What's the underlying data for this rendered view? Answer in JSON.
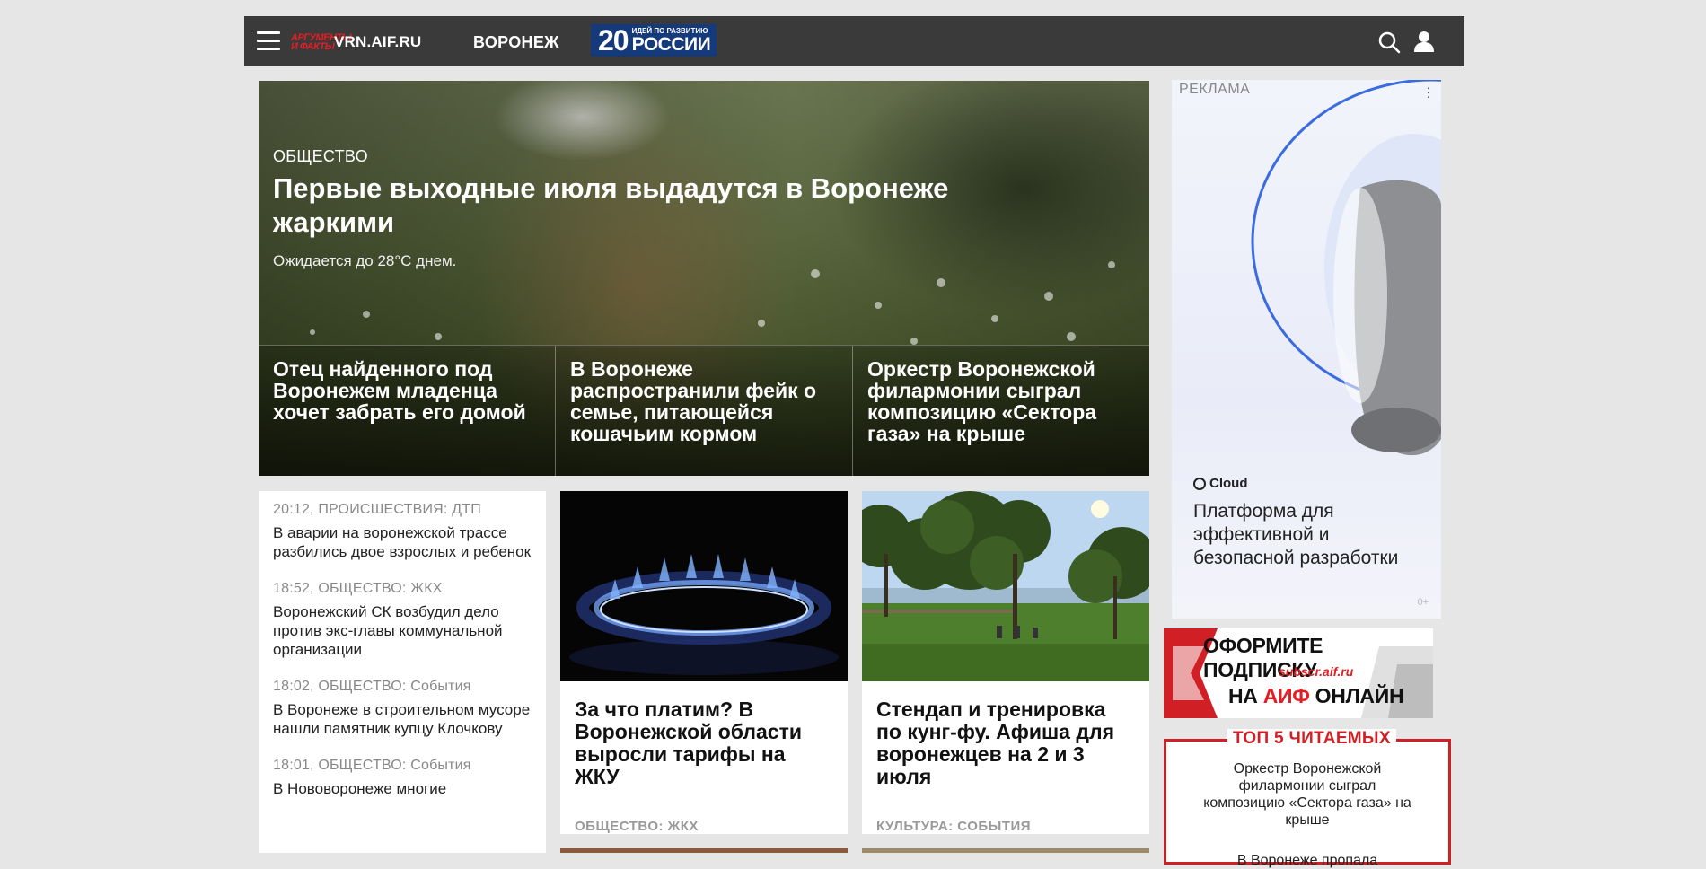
{
  "header": {
    "logo_mark": "АРГУМЕНТЫ И ФАКТЫ",
    "site": "VRN.AIF.RU",
    "city": "ВОРОНЕЖ",
    "promo_number": "20",
    "promo_small": "ИДЕЙ ПО РАЗВИТИЮ",
    "promo_big": "РОССИИ"
  },
  "hero": {
    "rubric": "ОБЩЕСТВО",
    "title": "Первые выходные июля выдадутся в Воронеже жаркими",
    "subtitle": "Ожидается до 28°C днем.",
    "cards": [
      {
        "title": "Отец найденного под Воронежем младенца хочет забрать его домой"
      },
      {
        "title": "В Воронеже распространили фейк о семье, питающейся кошачьим кормом"
      },
      {
        "title": "Оркестр Воронежской филармонии сыграл композицию «Сектора газа» на крыше"
      }
    ]
  },
  "news": [
    {
      "meta": "20:12, ПРОИСШЕСТВИЯ: ДТП",
      "title": "В аварии на воронежской трассе разбились двое взрослых и ребенок"
    },
    {
      "meta": "18:52, ОБЩЕСТВО: ЖКХ",
      "title": "Воронежский СК возбудил дело против экс-главы коммунальной организации"
    },
    {
      "meta": "18:02, ОБЩЕСТВО: События",
      "title": "В Воронеже в строительном мусоре нашли памятник купцу Клочкову"
    },
    {
      "meta": "18:01, ОБЩЕСТВО: События",
      "title": "В Нововоронеже многие"
    }
  ],
  "cards": [
    {
      "title": "За что платим? В Воронежской области выросли тарифы на ЖКУ",
      "tag": "ОБЩЕСТВО: ЖКХ",
      "image": "gas-burner-flame"
    },
    {
      "title": "Стендап и тренировка по кунг-фу. Афиша для воронежцев на 2 и 3 июля",
      "tag": "КУЛЬТУРА: СОБЫТИЯ",
      "image": "park-lake-trees"
    }
  ],
  "ad": {
    "label": "РЕКЛАМА",
    "brand": "Cloud",
    "text": "Платформа для эффективной и безопасной разработки",
    "age": "0+"
  },
  "subscribe": {
    "line1": "ОФОРМИТЕ ПОДПИСКУ",
    "line2": "subscr.aif.ru",
    "line3_a": "НА ",
    "line3_b": "АИФ",
    "line3_c": " ОНЛАЙН"
  },
  "top5": {
    "heading": "ТОП 5 ЧИТАЕМЫХ",
    "items": [
      "Оркестр Воронежской филармонии сыграл композицию «Сектора газа» на крыше",
      "В Воронеже пропала"
    ]
  },
  "colors": {
    "header_bg": "#3a3a3a",
    "brand_red": "#e31e24",
    "promo_blue": "#143a7c"
  }
}
